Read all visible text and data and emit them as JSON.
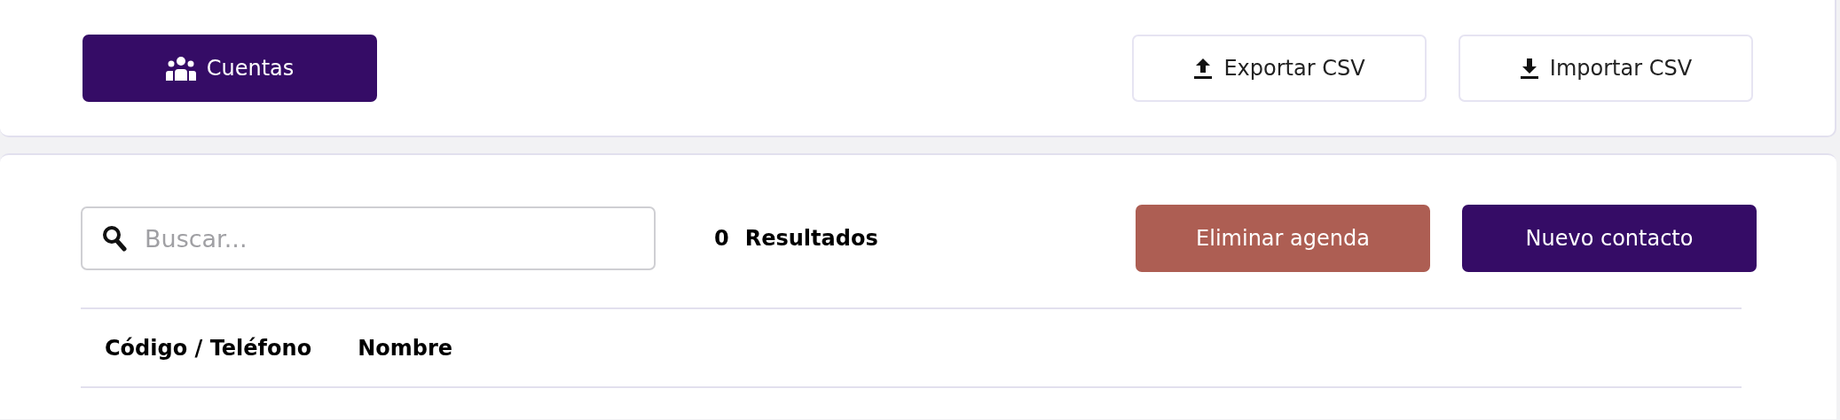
{
  "header": {
    "accounts_button": "Cuentas",
    "export_button": "Exportar CSV",
    "import_button": "Importar CSV"
  },
  "toolbar": {
    "search": {
      "placeholder": "Buscar..."
    },
    "result_count": "0",
    "result_label": "Resultados",
    "delete_button": "Eliminar agenda",
    "new_button": "Nuevo contacto"
  },
  "table": {
    "columns": [
      "Código / Teléfono",
      "Nombre"
    ]
  }
}
